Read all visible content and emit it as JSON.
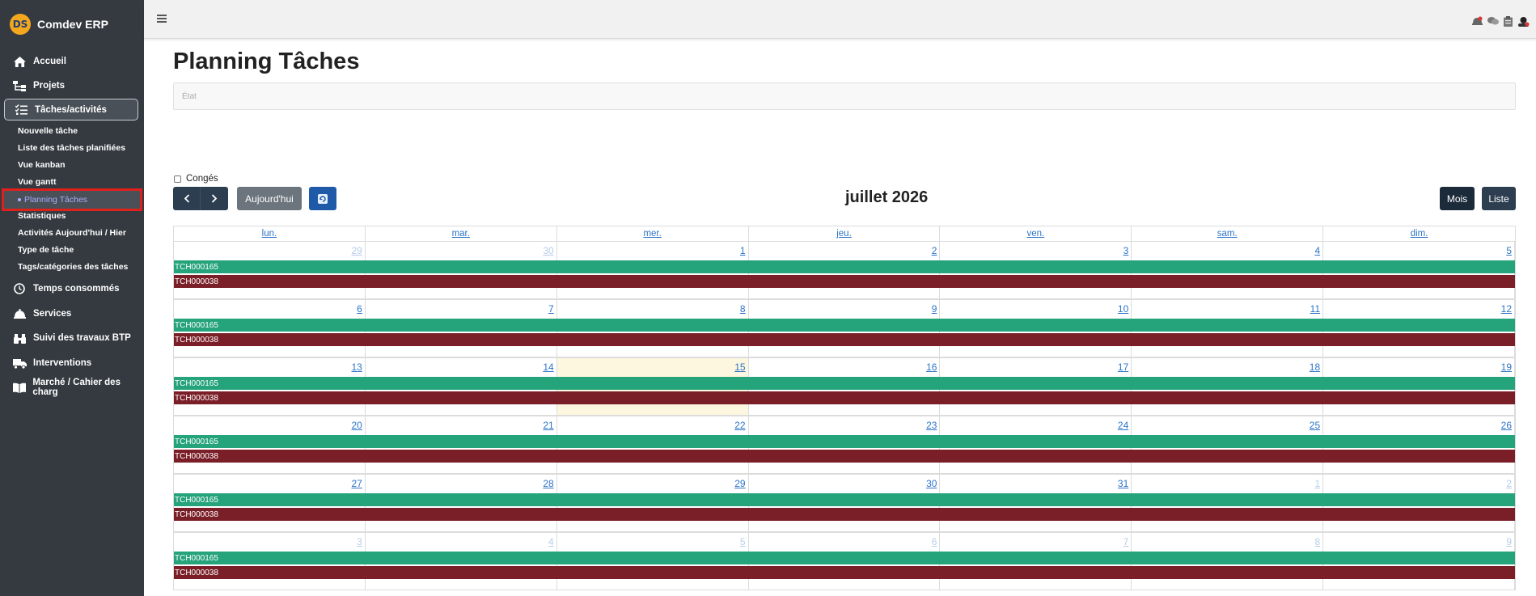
{
  "brand": {
    "name": "Comdev ERP",
    "logo_text": "DS"
  },
  "sidebar": {
    "items": [
      {
        "label": "Accueil",
        "icon": "home-icon"
      },
      {
        "label": "Projets",
        "icon": "sitemap-icon"
      },
      {
        "label": "Tâches/activités",
        "icon": "tasks-icon"
      },
      {
        "label": "Temps consommés",
        "icon": "clock-icon"
      },
      {
        "label": "Services",
        "icon": "bell-icon"
      },
      {
        "label": "Suivi des travaux BTP",
        "icon": "binoculars-icon"
      },
      {
        "label": "Interventions",
        "icon": "truck-icon"
      },
      {
        "label": "Marché / Cahier des charg",
        "icon": "book-icon"
      }
    ],
    "subitems": [
      "Nouvelle tâche",
      "Liste des tâches planifiées",
      "Vue kanban",
      "Vue gantt",
      "Planning Tâches",
      "Statistiques",
      "Activités Aujourd'hui / Hier",
      "Type de tâche",
      "Tags/catégories des tâches"
    ]
  },
  "page": {
    "title": "Planning Tâches",
    "etat_placeholder": "État",
    "conges_label": "Congés"
  },
  "toolbar": {
    "today_label": "Aujourd'hui",
    "month_label": "Mois",
    "list_label": "Liste",
    "current_period": "juillet 2026"
  },
  "calendar": {
    "weekdays": [
      "lun.",
      "mar.",
      "mer.",
      "jeu.",
      "ven.",
      "sam.",
      "dim."
    ],
    "weeks": [
      [
        "29",
        "30",
        "1",
        "2",
        "3",
        "4",
        "5"
      ],
      [
        "6",
        "7",
        "8",
        "9",
        "10",
        "11",
        "12"
      ],
      [
        "13",
        "14",
        "15",
        "16",
        "17",
        "18",
        "19"
      ],
      [
        "20",
        "21",
        "22",
        "23",
        "24",
        "25",
        "26"
      ],
      [
        "27",
        "28",
        "29",
        "30",
        "31",
        "1",
        "2"
      ],
      [
        "3",
        "4",
        "5",
        "6",
        "7",
        "8",
        "9"
      ]
    ],
    "events": [
      {
        "label": "TCH000165",
        "color": "#25a37a"
      },
      {
        "label": "TCH000038",
        "color": "#7a1f28"
      }
    ],
    "today_color": "#fdf7df"
  }
}
